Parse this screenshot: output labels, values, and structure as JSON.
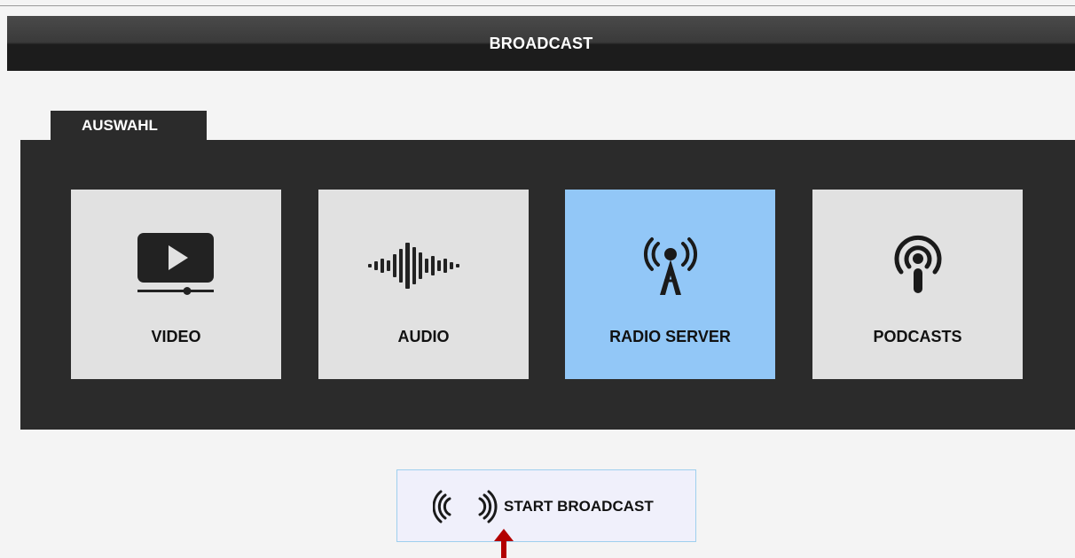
{
  "header": {
    "title": "BROADCAST"
  },
  "tab": {
    "label": "AUSWAHL"
  },
  "tiles": [
    {
      "label": "VIDEO",
      "icon": "video-play-icon",
      "selected": false
    },
    {
      "label": "AUDIO",
      "icon": "audio-waveform-icon",
      "selected": false
    },
    {
      "label": "RADIO SERVER",
      "icon": "radio-tower-icon",
      "selected": true
    },
    {
      "label": "PODCASTS",
      "icon": "podcast-icon",
      "selected": false
    }
  ],
  "start_button": {
    "label": "START BROADCAST",
    "icon": "broadcast-waves-icon"
  },
  "colors": {
    "selected_tile": "#92c7f7",
    "tile": "#e1e1e1",
    "panel": "#2b2b2b",
    "arrow": "#b30000"
  }
}
